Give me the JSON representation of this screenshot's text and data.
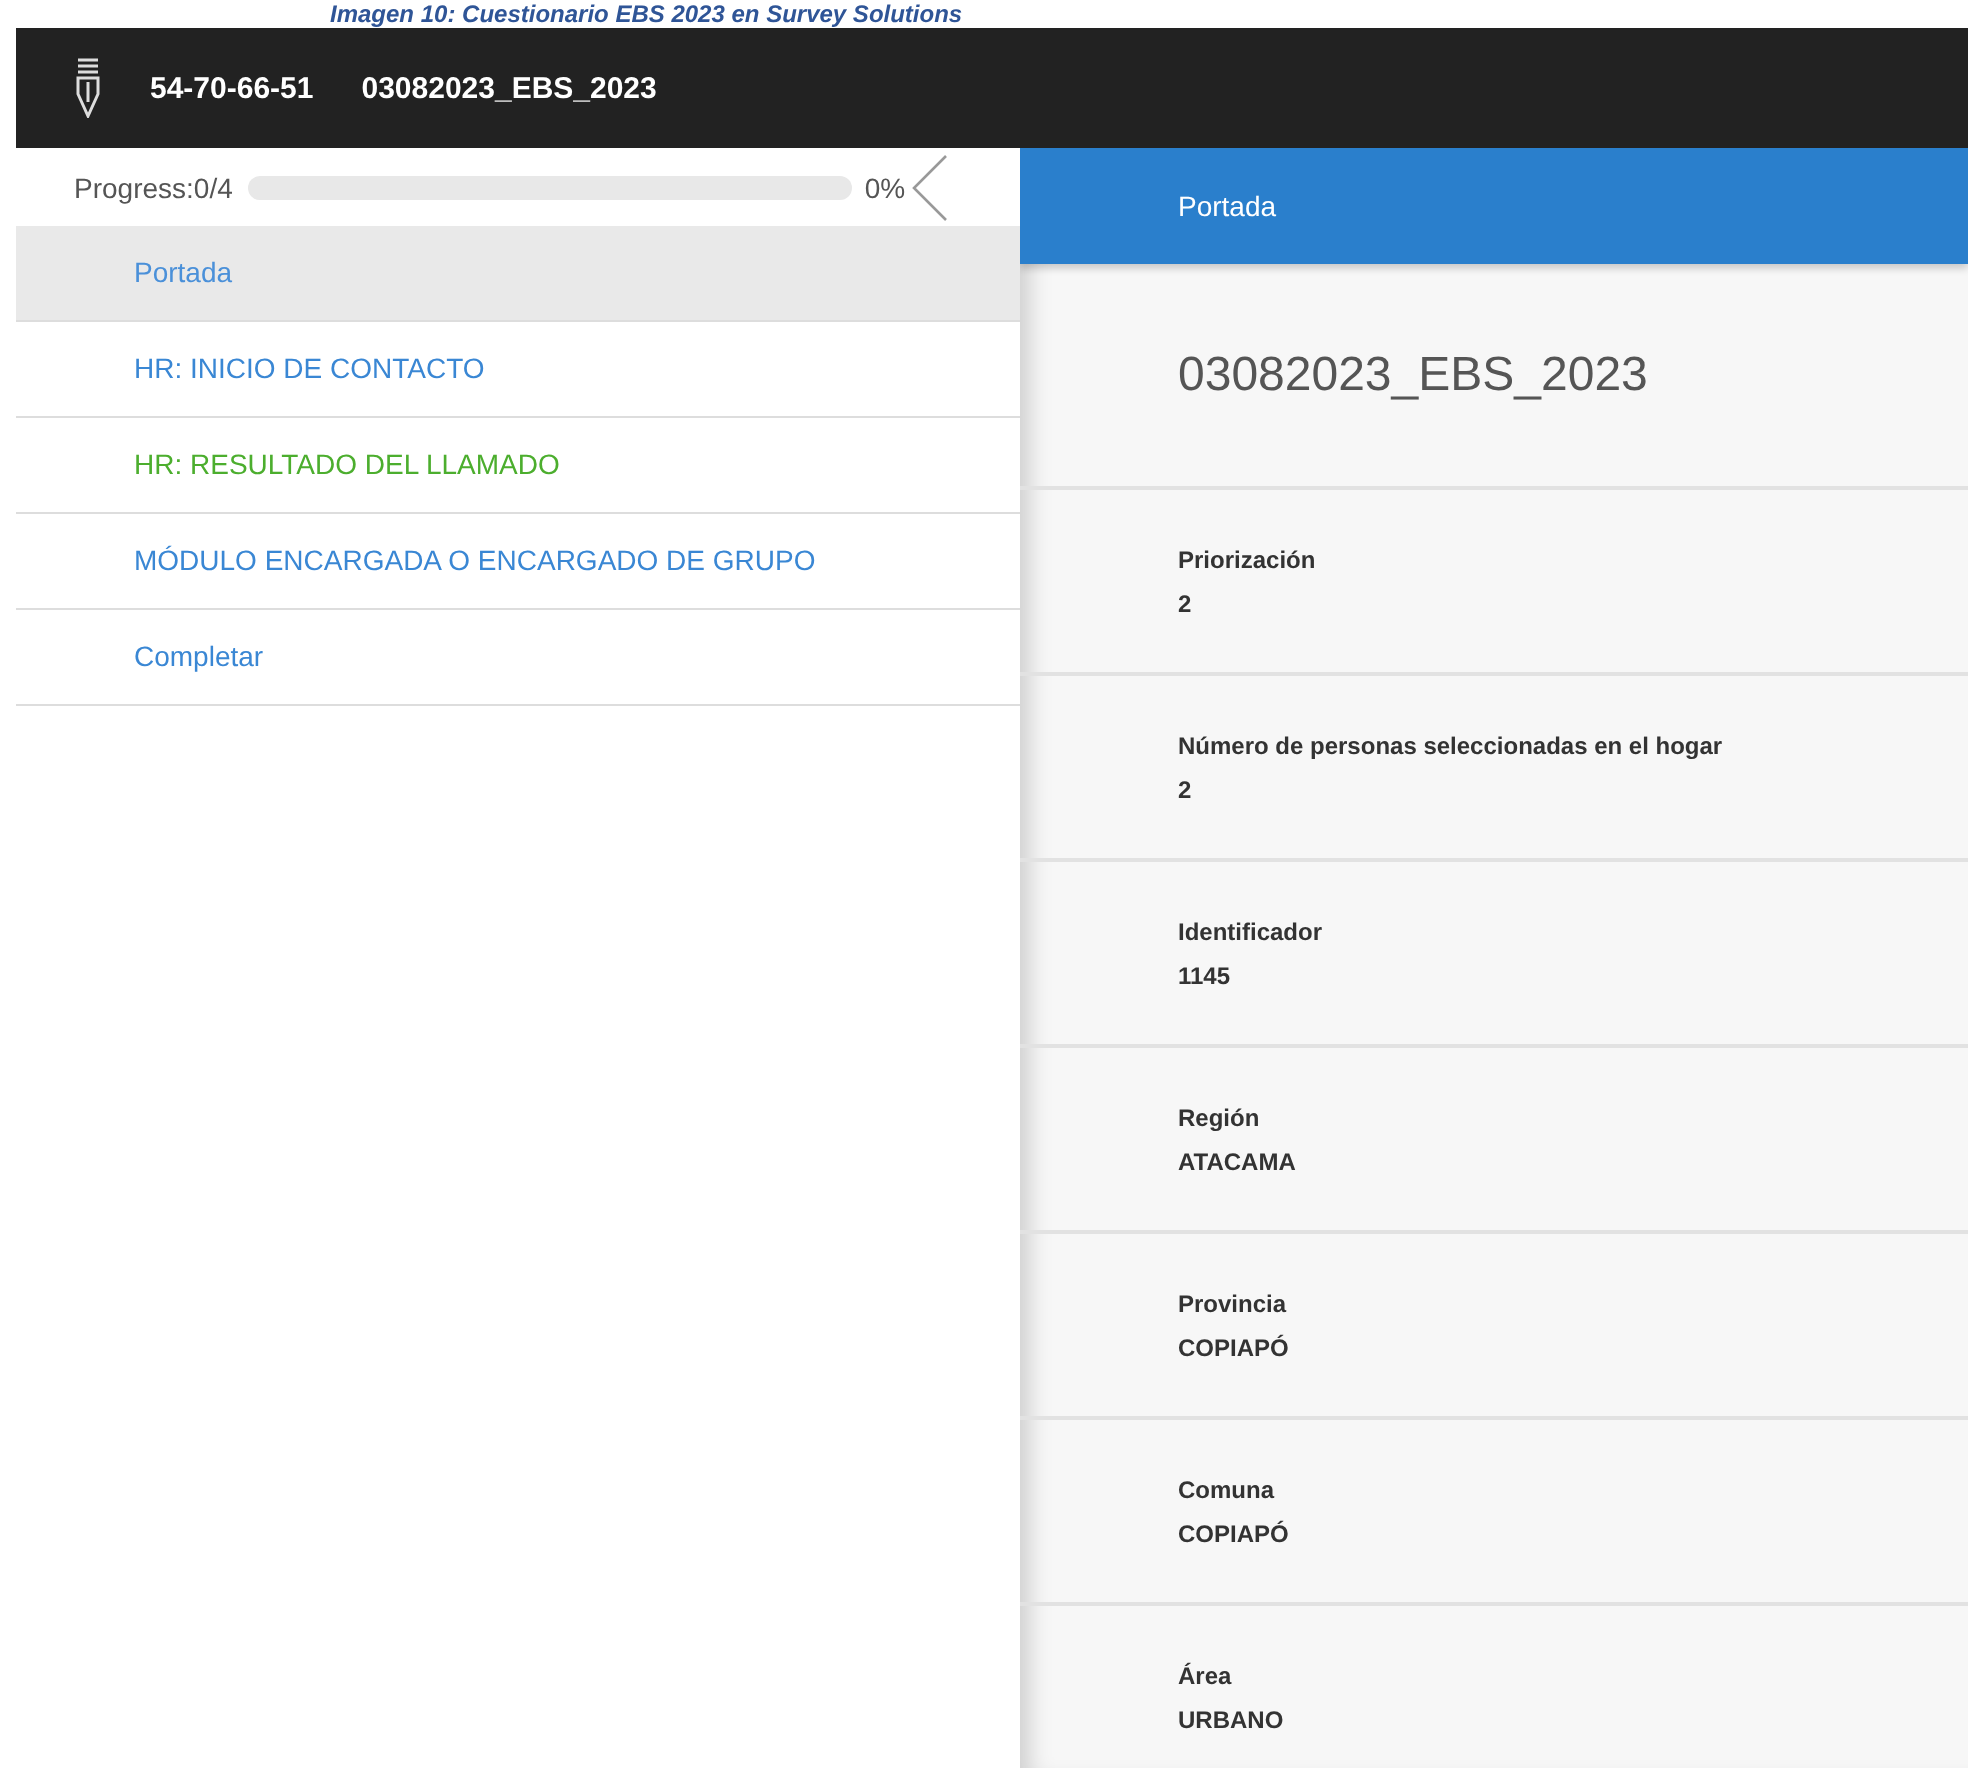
{
  "caption": "Imagen 10: Cuestionario EBS 2023 en Survey Solutions",
  "header": {
    "interview_key": "54-70-66-51",
    "questionnaire": "03082023_EBS_2023"
  },
  "progress": {
    "label": "Progress:0/4",
    "level": 0,
    "percent": "0%"
  },
  "sidebar": {
    "items": [
      {
        "label": "Portada",
        "selected": true,
        "color": "#4a90d9"
      },
      {
        "label": "HR: INICIO DE CONTACTO",
        "selected": false,
        "color": "#3a87d4"
      },
      {
        "label": "HR: RESULTADO DEL LLAMADO",
        "selected": false,
        "color": "#4cae2e"
      },
      {
        "label": "MÓDULO ENCARGADA O ENCARGADO DE GRUPO",
        "selected": false,
        "color": "#3a87d4"
      },
      {
        "label": "Completar",
        "selected": false,
        "color": "#3a87d4"
      }
    ]
  },
  "section_bar": {
    "title": "Portada"
  },
  "cover_title": "03082023_EBS_2023",
  "fields": [
    {
      "label": "Priorización",
      "value": "2"
    },
    {
      "label": "Número de personas seleccionadas en el hogar",
      "value": "2"
    },
    {
      "label": "Identificador",
      "value": "1145"
    },
    {
      "label": "Región",
      "value": "ATACAMA"
    },
    {
      "label": "Provincia",
      "value": "COPIAPÓ"
    },
    {
      "label": "Comuna",
      "value": "COPIAPÓ"
    },
    {
      "label": "Área",
      "value": "URBANO"
    }
  ]
}
